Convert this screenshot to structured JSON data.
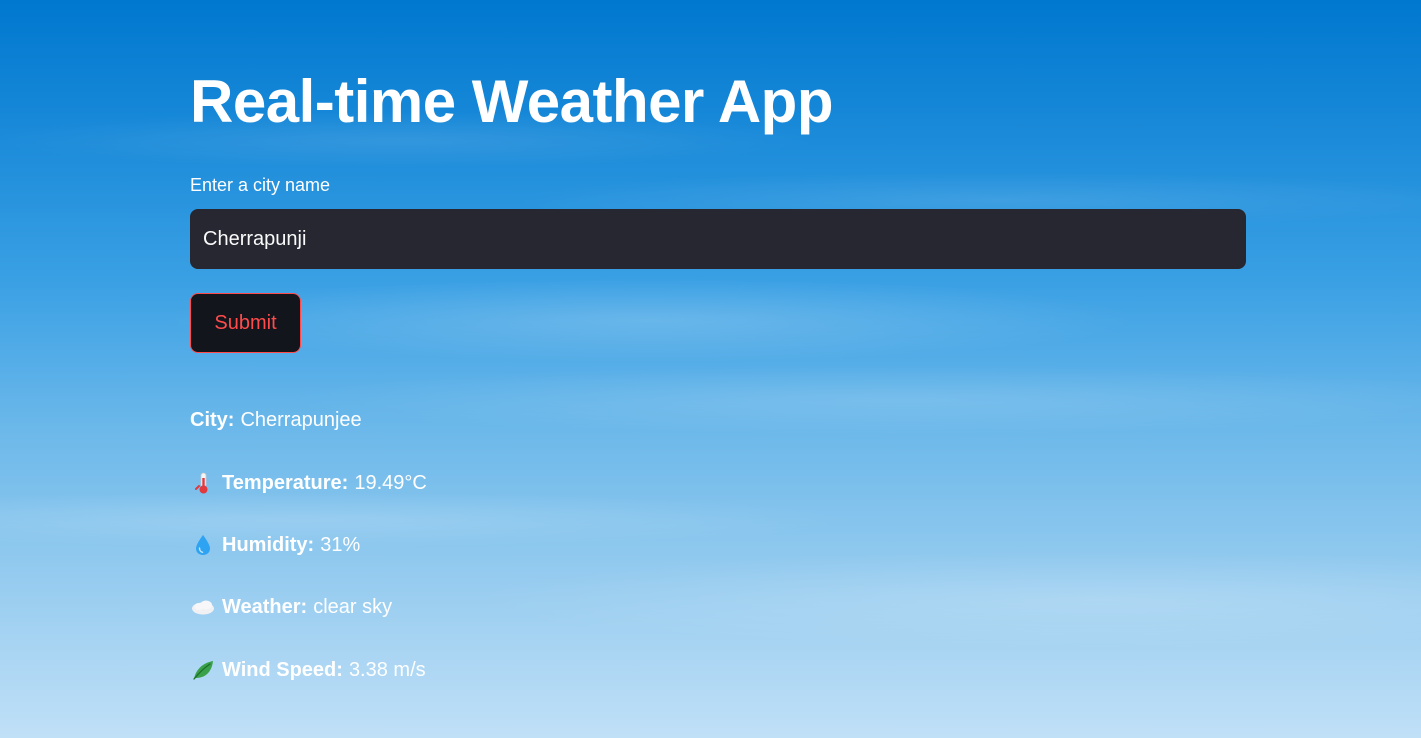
{
  "app": {
    "title": "Real-time Weather App"
  },
  "form": {
    "label": "Enter a city name",
    "city_value": "Cherrapunji",
    "submit_label": "Submit"
  },
  "results": {
    "city": {
      "label": "City:",
      "value": "Cherrapunjee"
    },
    "temperature": {
      "icon": "thermometer-icon",
      "label": "Temperature:",
      "value": "19.49°C"
    },
    "humidity": {
      "icon": "droplet-icon",
      "label": "Humidity:",
      "value": "31%"
    },
    "weather": {
      "icon": "cloud-icon",
      "label": "Weather:",
      "value": "clear sky"
    },
    "wind": {
      "icon": "leaf-icon",
      "label": "Wind Speed:",
      "value": "3.38 m/s"
    }
  },
  "colors": {
    "accent": "#ff4b4b",
    "input_bg": "#262730",
    "text": "#ffffff"
  }
}
